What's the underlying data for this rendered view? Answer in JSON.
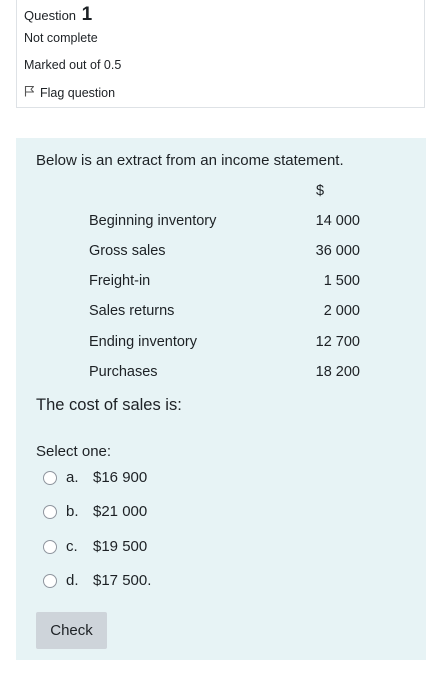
{
  "info": {
    "question_label": "Question",
    "question_number": "1",
    "state": "Not complete",
    "grade": "Marked out of 0.5",
    "flag_label": "Flag question"
  },
  "question": {
    "intro": "Below is an extract from an income statement.",
    "currency_header": "$",
    "rows": [
      {
        "label": "Beginning inventory",
        "value": "14 000"
      },
      {
        "label": "Gross sales",
        "value": "36 000"
      },
      {
        "label": "Freight-in",
        "value": "1 500"
      },
      {
        "label": "Sales returns",
        "value": "2 000"
      },
      {
        "label": "Ending inventory",
        "value": "12 700"
      },
      {
        "label": "Purchases",
        "value": "18 200"
      }
    ],
    "prompt": "The cost of sales is:",
    "select_label": "Select one:",
    "options": [
      {
        "letter": "a.",
        "text": "$16 900"
      },
      {
        "letter": "b.",
        "text": "$21 000"
      },
      {
        "letter": "c.",
        "text": "$19 500"
      },
      {
        "letter": "d.",
        "text": "$17 500."
      }
    ],
    "check_label": "Check"
  }
}
